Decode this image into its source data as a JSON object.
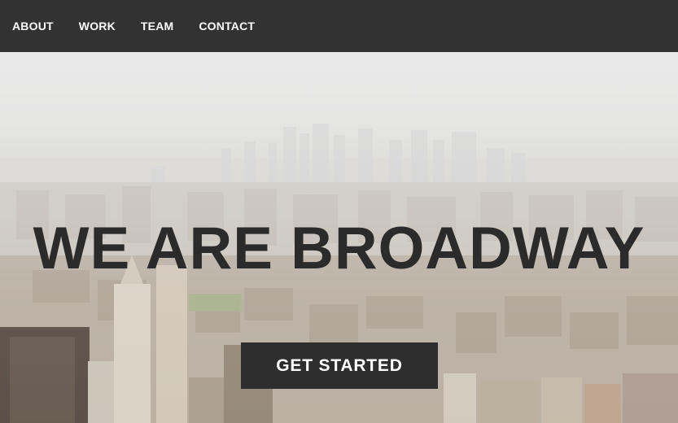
{
  "nav": {
    "items": [
      {
        "label": "ABOUT"
      },
      {
        "label": "WORK"
      },
      {
        "label": "TEAM"
      },
      {
        "label": "CONTACT"
      }
    ]
  },
  "hero": {
    "headline": "WE ARE BROADWAY",
    "cta_label": "GET STARTED"
  },
  "colors": {
    "nav_background": "#323232",
    "nav_text": "#ffffff",
    "headline_text": "#2b2b2b",
    "button_background": "#2e2e2e",
    "button_text": "#ffffff"
  }
}
